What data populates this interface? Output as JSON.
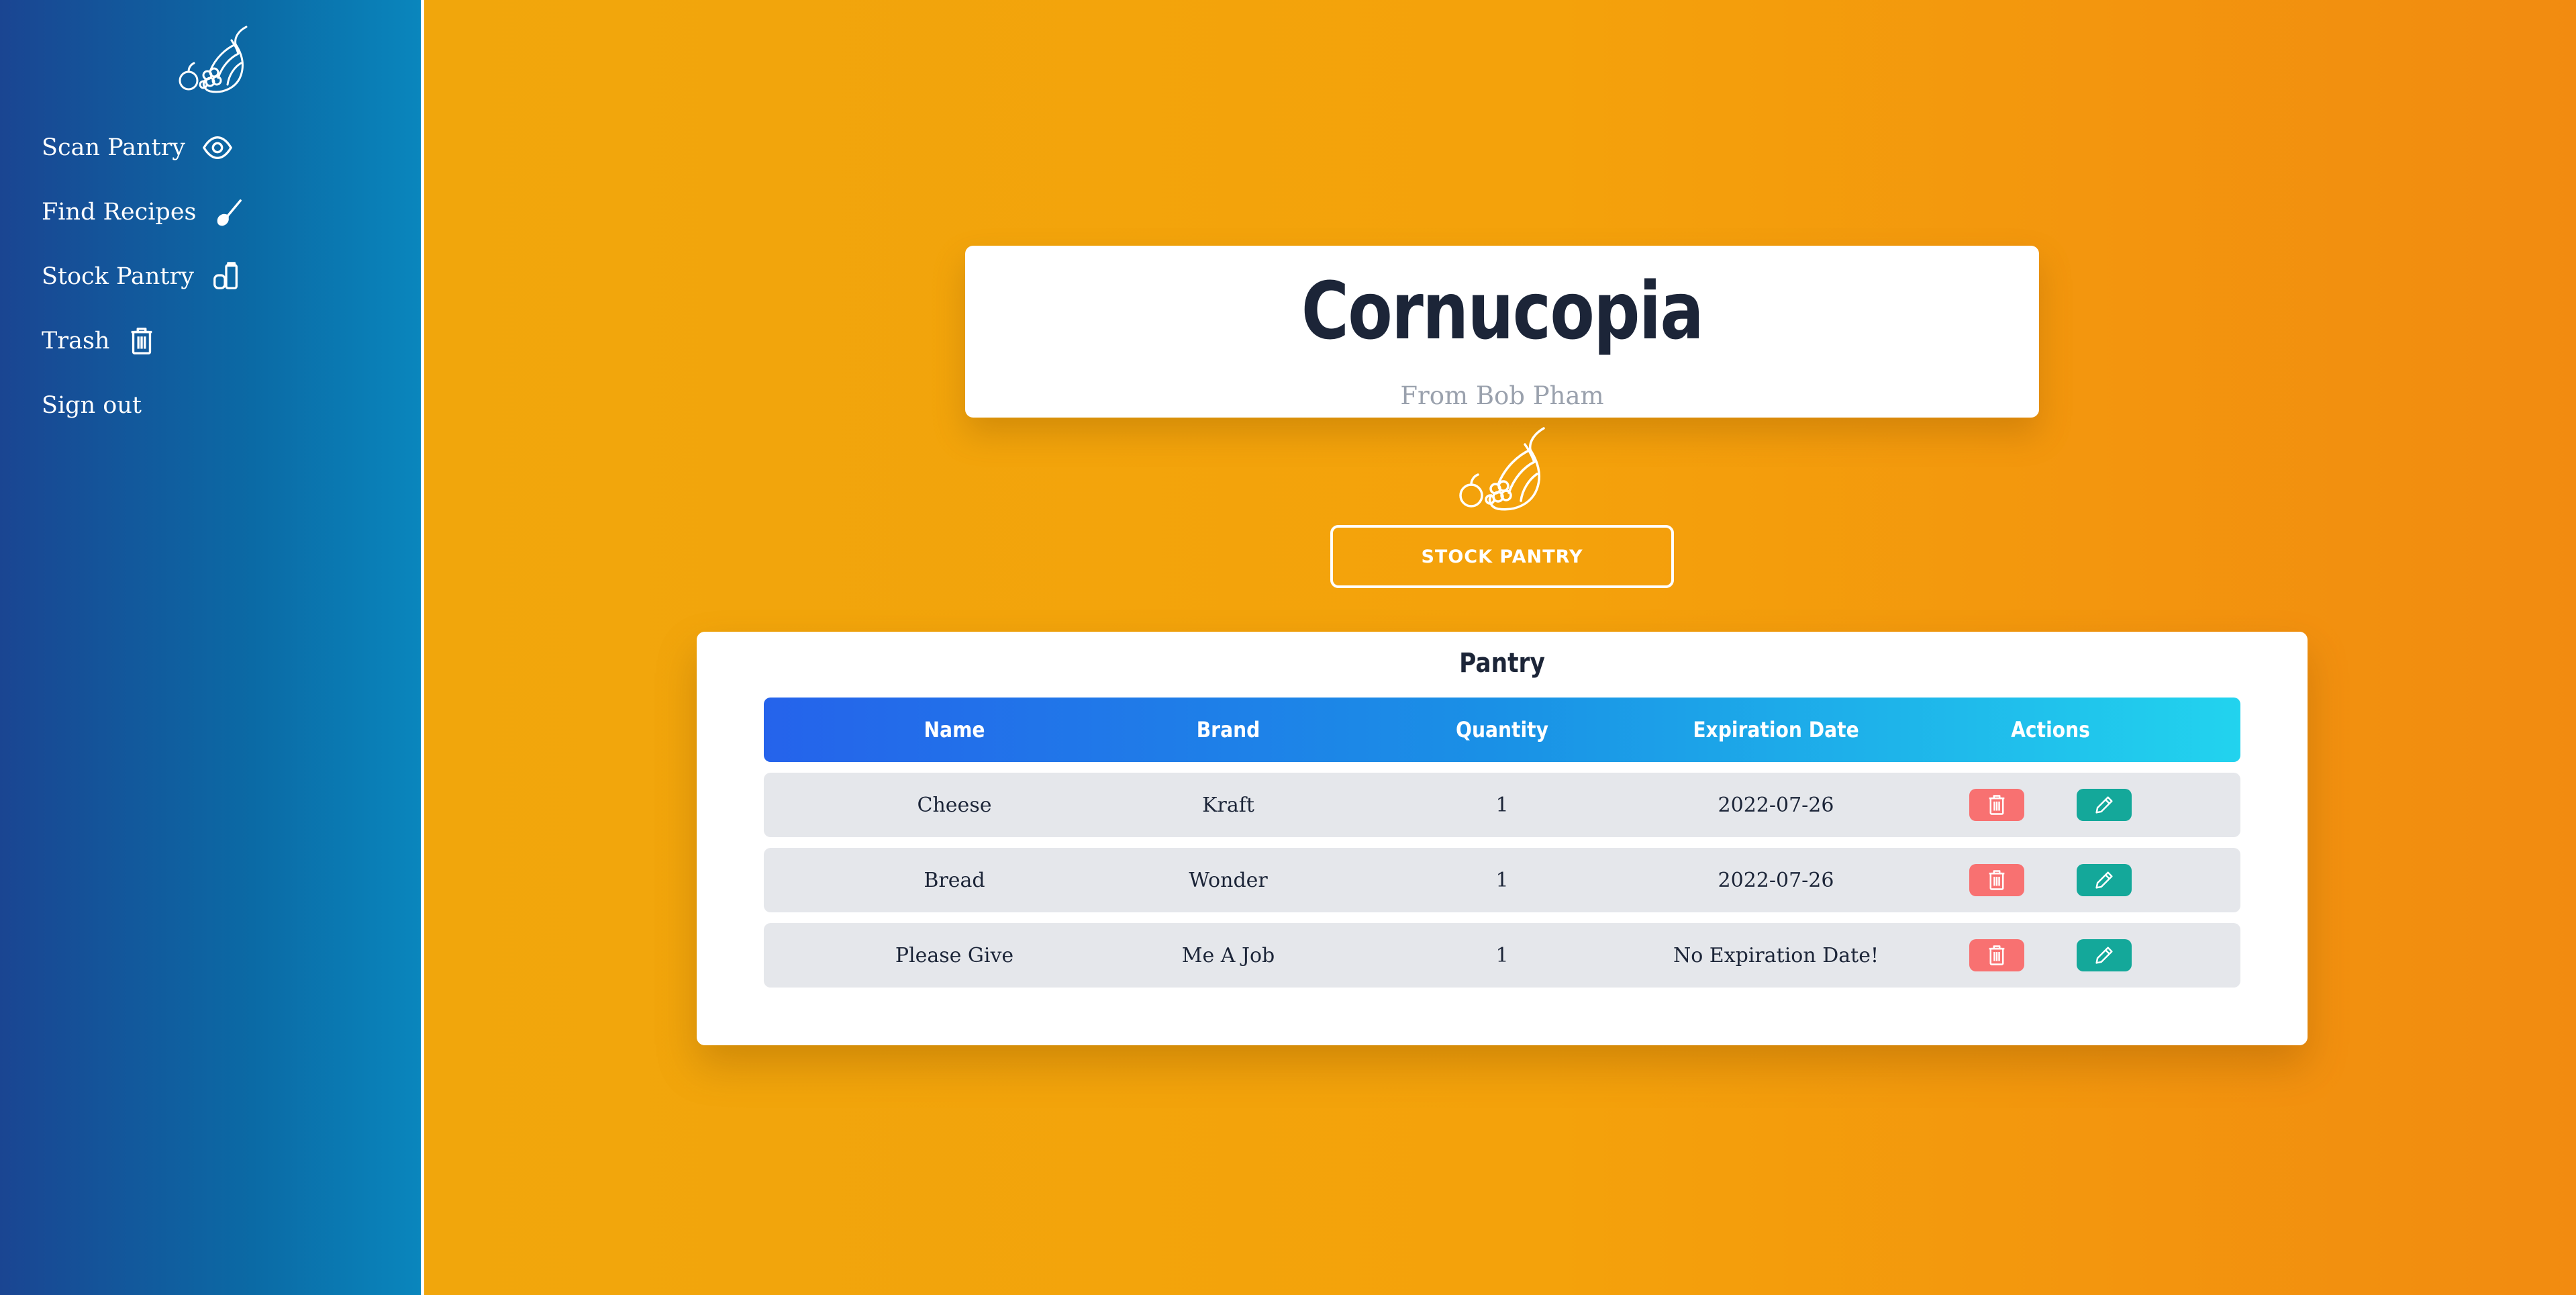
{
  "sidebar": {
    "logo_icon": "cornucopia-icon",
    "items": [
      {
        "label": "Scan Pantry",
        "icon": "eye-icon"
      },
      {
        "label": "Find Recipes",
        "icon": "spoon-icon"
      },
      {
        "label": "Stock Pantry",
        "icon": "jars-icon"
      },
      {
        "label": "Trash",
        "icon": "trash-icon"
      },
      {
        "label": "Sign out",
        "icon": ""
      }
    ]
  },
  "header": {
    "title": "Cornucopia",
    "subtitle": "From Bob Pham"
  },
  "stock_button_label": "STOCK PANTRY",
  "pantry": {
    "title": "Pantry",
    "columns": [
      "Name",
      "Brand",
      "Quantity",
      "Expiration Date",
      "Actions"
    ],
    "rows": [
      {
        "name": "Cheese",
        "brand": "Kraft",
        "quantity": "1",
        "expiration": "2022-07-26"
      },
      {
        "name": "Bread",
        "brand": "Wonder",
        "quantity": "1",
        "expiration": "2022-07-26"
      },
      {
        "name": "Please Give",
        "brand": "Me A Job",
        "quantity": "1",
        "expiration": "No Expiration Date!"
      }
    ]
  },
  "colors": {
    "sidebar_start": "#1a4592",
    "sidebar_end": "#0a86bd",
    "background_start": "#f0a80c",
    "background_end": "#f28b10",
    "delete_button": "#f87171",
    "edit_button": "#14a89a",
    "header_gradient_start": "#2563eb",
    "header_gradient_end": "#22d3ee"
  }
}
